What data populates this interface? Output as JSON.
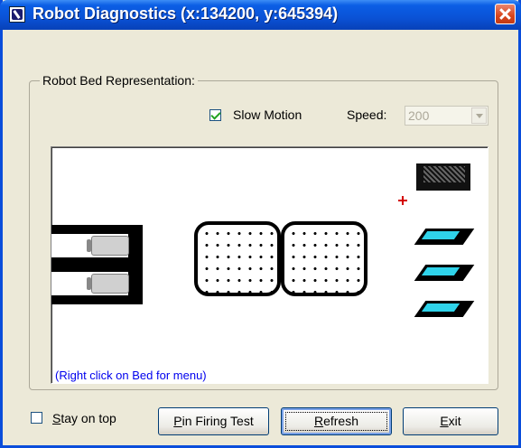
{
  "window": {
    "title": "Robot Diagnostics (x:134200, y:645394)"
  },
  "group": {
    "label": "Robot Bed Representation:"
  },
  "controls": {
    "slow_motion_label": "Slow Motion",
    "slow_motion_checked": true,
    "speed_label": "Speed:",
    "speed_value": "200"
  },
  "bed": {
    "hint": "(Right click on Bed for menu)"
  },
  "footer": {
    "stay_on_top_label": "Stay on top",
    "stay_on_top_checked": false,
    "pin_firing_test_label": "Pin Firing Test",
    "refresh_label": "Refresh",
    "exit_label": "Exit"
  },
  "colors": {
    "title_bar": "#0a52d6",
    "feeder_fill": "#2fd3ea",
    "marker": "#d40000",
    "hint_text": "#0000ee"
  },
  "icons": [
    "app-icon",
    "close-icon",
    "check-icon",
    "dropdown-arrow-icon"
  ]
}
